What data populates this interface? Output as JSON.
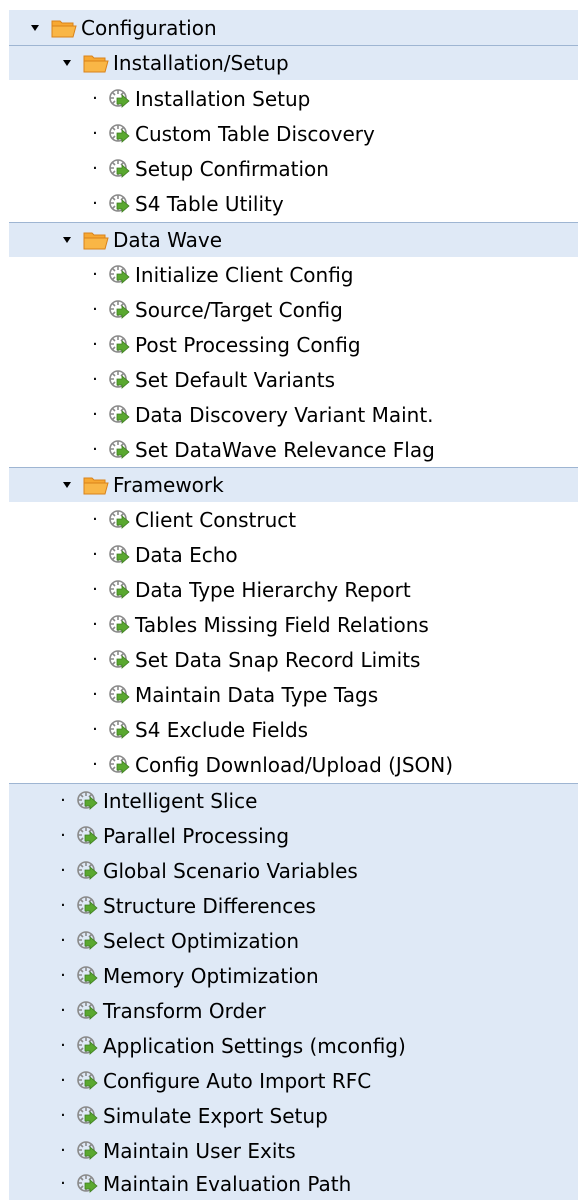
{
  "tree": {
    "root": {
      "label": "Configuration",
      "icon": "folder-open-icon",
      "expanded": true
    },
    "groups": [
      {
        "label": "Installation/Setup",
        "icon": "folder-open-icon",
        "expanded": true,
        "items": [
          {
            "label": "Installation Setup",
            "icon": "transaction-icon"
          },
          {
            "label": "Custom Table Discovery",
            "icon": "transaction-icon"
          },
          {
            "label": "Setup Confirmation",
            "icon": "transaction-icon"
          },
          {
            "label": "S4 Table Utility",
            "icon": "transaction-icon"
          }
        ]
      },
      {
        "label": "Data Wave",
        "icon": "folder-open-icon",
        "expanded": true,
        "items": [
          {
            "label": "Initialize Client Config",
            "icon": "transaction-icon"
          },
          {
            "label": "Source/Target Config",
            "icon": "transaction-icon"
          },
          {
            "label": "Post Processing Config",
            "icon": "transaction-icon"
          },
          {
            "label": "Set Default Variants",
            "icon": "transaction-icon"
          },
          {
            "label": "Data Discovery Variant Maint.",
            "icon": "transaction-icon"
          },
          {
            "label": "Set DataWave Relevance Flag",
            "icon": "transaction-icon"
          }
        ]
      },
      {
        "label": "Framework",
        "icon": "folder-open-icon",
        "expanded": true,
        "items": [
          {
            "label": "Client Construct",
            "icon": "transaction-icon"
          },
          {
            "label": "Data Echo",
            "icon": "transaction-icon"
          },
          {
            "label": "Data Type Hierarchy Report",
            "icon": "transaction-icon"
          },
          {
            "label": "Tables Missing Field Relations",
            "icon": "transaction-icon"
          },
          {
            "label": "Set Data Snap Record Limits",
            "icon": "transaction-icon"
          },
          {
            "label": "Maintain Data Type Tags",
            "icon": "transaction-icon"
          },
          {
            "label": "S4 Exclude Fields",
            "icon": "transaction-icon"
          },
          {
            "label": "Config Download/Upload (JSON)",
            "icon": "transaction-icon"
          }
        ]
      }
    ],
    "root_items": [
      {
        "label": "Intelligent Slice",
        "icon": "transaction-icon"
      },
      {
        "label": "Parallel Processing",
        "icon": "transaction-icon"
      },
      {
        "label": "Global Scenario Variables",
        "icon": "transaction-icon"
      },
      {
        "label": "Structure Differences",
        "icon": "transaction-icon"
      },
      {
        "label": "Select Optimization",
        "icon": "transaction-icon"
      },
      {
        "label": "Memory Optimization",
        "icon": "transaction-icon"
      },
      {
        "label": "Transform Order",
        "icon": "transaction-icon"
      },
      {
        "label": "Application Settings (mconfig)",
        "icon": "transaction-icon"
      },
      {
        "label": "Configure Auto Import RFC",
        "icon": "transaction-icon"
      },
      {
        "label": "Simulate Export Setup",
        "icon": "transaction-icon"
      },
      {
        "label": "Maintain User Exits",
        "icon": "transaction-icon"
      },
      {
        "label": "Maintain Evaluation Path",
        "icon": "transaction-icon"
      }
    ]
  },
  "colors": {
    "group_background": "#dfe9f6",
    "group_border": "#9eb5d2",
    "folder_fill": "#f7a832",
    "folder_stroke": "#d9821a",
    "transaction_icon_green": "#5aa830",
    "transaction_icon_gray": "#8a8a8a"
  }
}
